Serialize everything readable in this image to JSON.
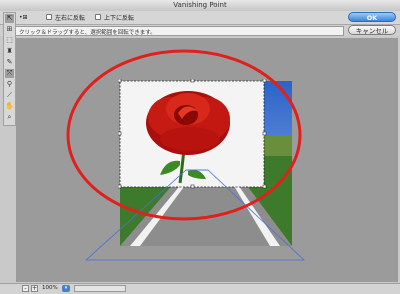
{
  "window": {
    "title": "Vanishing Point"
  },
  "options": {
    "tool_mode": "•⊞",
    "flip_h_label": "左右に反転",
    "flip_v_label": "上下に反転"
  },
  "info": {
    "text": "クリック＆ドラッグすると、選択範囲を回転できます。"
  },
  "buttons": {
    "ok": "OK",
    "cancel": "キャンセル"
  },
  "tools": [
    {
      "name": "edit-plane-tool",
      "glyph": "⇱"
    },
    {
      "name": "create-plane-tool",
      "glyph": "⊞"
    },
    {
      "name": "marquee-tool",
      "glyph": "⬚"
    },
    {
      "name": "stamp-tool",
      "glyph": "♜"
    },
    {
      "name": "brush-tool",
      "glyph": "✎"
    },
    {
      "name": "transform-tool",
      "glyph": "⤧"
    },
    {
      "name": "eyedropper-tool",
      "glyph": "⚲"
    },
    {
      "name": "measure-tool",
      "glyph": "⟋"
    },
    {
      "name": "hand-tool",
      "glyph": "✋"
    },
    {
      "name": "zoom-tool",
      "glyph": "⌕"
    }
  ],
  "status": {
    "zoom_out": "-",
    "zoom_in": "+",
    "zoom": "100%"
  },
  "colors": {
    "ellipse": "#e0201c",
    "plane": "#4a6fd8",
    "ok_button": "#3b86d9"
  }
}
